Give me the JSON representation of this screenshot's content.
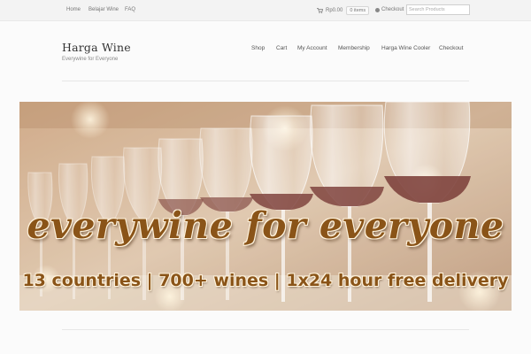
{
  "topbar": {
    "links": [
      {
        "label": "Home"
      },
      {
        "label": "Belajar Wine"
      },
      {
        "label": "FAQ"
      }
    ],
    "cart_total": "Rp0.00",
    "cart_items": "0 items",
    "checkout_label": "Checkout",
    "search_placeholder": "Search Products"
  },
  "header": {
    "title": "Harga Wine",
    "tagline": "Everywine for Everyone",
    "nav": [
      {
        "label": "Shop"
      },
      {
        "label": "Cart"
      },
      {
        "label": "My Account"
      },
      {
        "label": "Membership"
      },
      {
        "label": "Harga Wine Cooler"
      },
      {
        "label": "Checkout"
      }
    ]
  },
  "banner": {
    "headline": "everywine for everyone",
    "subline": "13 countries | 700+ wines | 1x24 hour free delivery"
  },
  "colors": {
    "banner_text": "#8a5418",
    "wine": "#6e2a24"
  }
}
